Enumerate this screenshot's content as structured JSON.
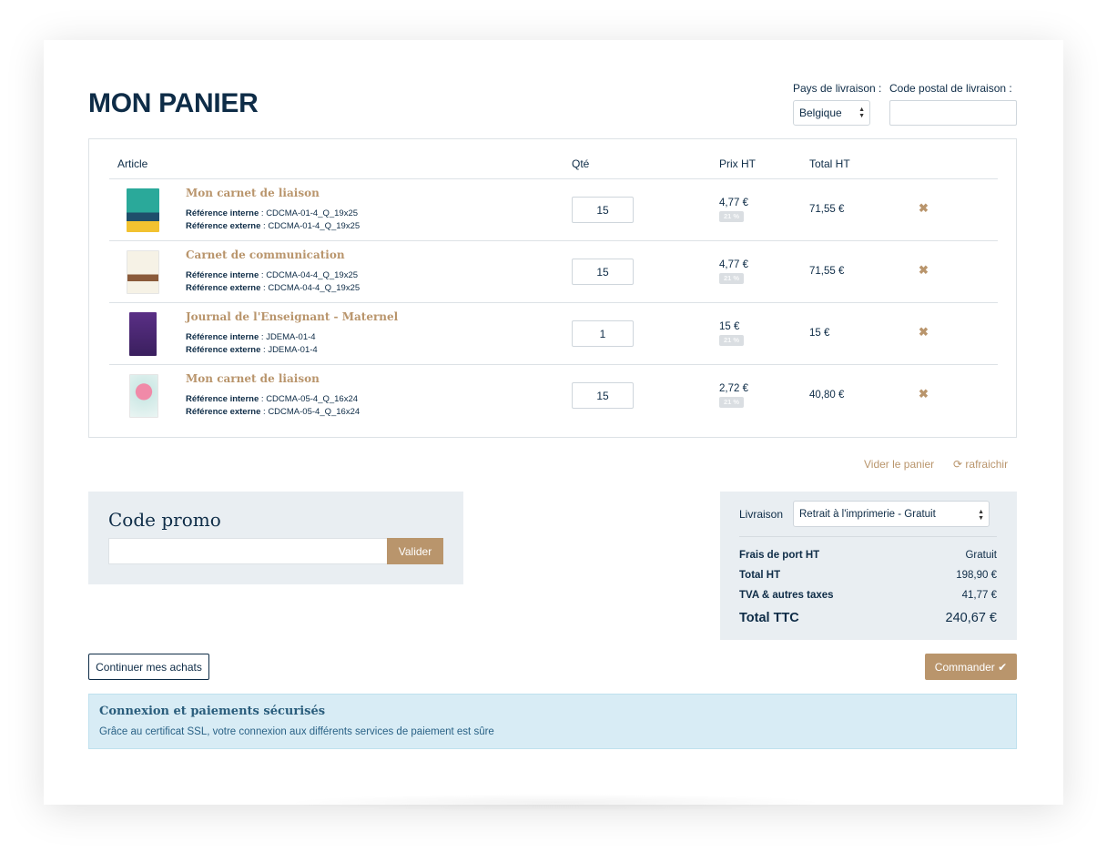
{
  "page": {
    "title": "MON PANIER"
  },
  "shipping": {
    "country_label": "Pays de livraison :",
    "country_value": "Belgique",
    "zip_label": "Code postal de livraison :",
    "zip_value": ""
  },
  "cart": {
    "headers": {
      "article": "Article",
      "qty": "Qté",
      "price": "Prix HT",
      "total": "Total HT"
    },
    "ref_internal_label": "Référence interne",
    "ref_external_label": "Référence externe",
    "items": [
      {
        "name": "Mon carnet de liaison",
        "ref_internal": "CDCMA-01-4_Q_19x25",
        "ref_external": "CDCMA-01-4_Q_19x25",
        "qty": "15",
        "price": "4,77 €",
        "tax": "21 %",
        "total": "71,55 €",
        "thumb_color": "#2aa99a"
      },
      {
        "name": "Carnet de communication",
        "ref_internal": "CDCMA-04-4_Q_19x25",
        "ref_external": "CDCMA-04-4_Q_19x25",
        "qty": "15",
        "price": "4,77 €",
        "tax": "21 %",
        "total": "71,55 €",
        "thumb_color": "#f2eee4"
      },
      {
        "name": "Journal de l'Enseignant - Maternel",
        "ref_internal": "JDEMA-01-4",
        "ref_external": "JDEMA-01-4",
        "qty": "1",
        "price": "15 €",
        "tax": "21 %",
        "total": "15 €",
        "thumb_color": "#4b2a6e"
      },
      {
        "name": "Mon carnet de liaison",
        "ref_internal": "CDCMA-05-4_Q_16x24",
        "ref_external": "CDCMA-05-4_Q_16x24",
        "qty": "15",
        "price": "2,72 €",
        "tax": "21 %",
        "total": "40,80 €",
        "thumb_color": "#d7ecea"
      }
    ],
    "empty_label": "Vider le panier",
    "refresh_label": "rafraichir"
  },
  "promo": {
    "title": "Code promo",
    "value": "",
    "button": "Valider"
  },
  "summary": {
    "delivery_label": "Livraison",
    "delivery_value": "Retrait à l'imprimerie - Gratuit",
    "shipping_cost_label": "Frais de port HT",
    "shipping_cost_value": "Gratuit",
    "total_ht_label": "Total HT",
    "total_ht_value": "198,90 €",
    "tva_label": "TVA & autres taxes",
    "tva_value": "41,77 €",
    "total_ttc_label": "Total TTC",
    "total_ttc_value": "240,67 €"
  },
  "buttons": {
    "continue": "Continuer mes achats",
    "order": "Commander"
  },
  "secure": {
    "title": "Connexion et paiements sécurisés",
    "text": "Grâce au certificat SSL, votre connexion aux différents services de paiement est sûre"
  },
  "colors": {
    "accent": "#b9956c",
    "navy": "#0e2c47",
    "panel": "#e9eef2",
    "info_bg": "#d8ecf5"
  }
}
